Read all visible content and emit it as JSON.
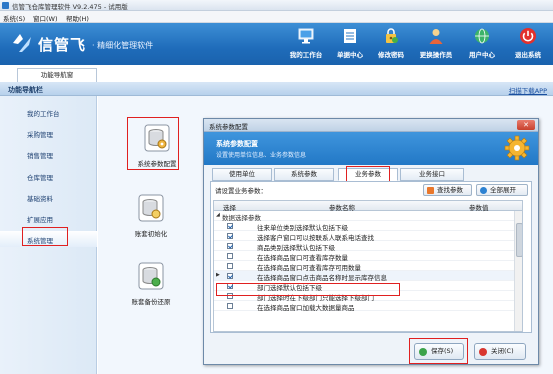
{
  "window": {
    "title": "信管飞仓库管理软件 V9.2.475 - 试用版"
  },
  "menu": {
    "items": [
      "系统(S)",
      "窗口(W)",
      "帮助(H)"
    ]
  },
  "brand": {
    "logo_text": "信管飞",
    "slogan": "· 精细化管理软件",
    "accent": "#1f6cba"
  },
  "toolbar": {
    "items": [
      {
        "label": "我的工作台",
        "icon": "monitor-icon"
      },
      {
        "label": "单据中心",
        "icon": "document-icon"
      },
      {
        "label": "修改密码",
        "icon": "key-icon"
      },
      {
        "label": "更换操作员",
        "icon": "user-icon"
      },
      {
        "label": "用户中心",
        "icon": "globe-icon"
      },
      {
        "label": "退出系统",
        "icon": "power-icon"
      }
    ]
  },
  "nav_tab": {
    "label": "功能导航窗"
  },
  "nav_header": {
    "title": "功能导航栏",
    "download_link": "扫描下载APP"
  },
  "sidebar": {
    "items": [
      {
        "label": "我的工作台"
      },
      {
        "label": "采购管理"
      },
      {
        "label": "销售管理"
      },
      {
        "label": "仓库管理"
      },
      {
        "label": "基础资料"
      },
      {
        "label": "扩展应用"
      },
      {
        "label": "系统管理"
      }
    ],
    "selected": "系统管理"
  },
  "tiles": [
    {
      "label": "系统参数配置",
      "icon": "database-gear-icon"
    },
    {
      "label": "账套初始化",
      "icon": "database-icon"
    },
    {
      "label": "账套备份还原",
      "icon": "database-restore-icon"
    }
  ],
  "dialog": {
    "title": "系统参数配置",
    "close_glyph": "✕",
    "band_heading": "系统参数配置",
    "band_subtitle": "设置使用单位信息、业务参数信息",
    "tabs": [
      {
        "label": "使用单位"
      },
      {
        "label": "系统参数"
      },
      {
        "label": "业务参数"
      },
      {
        "label": "业务接口"
      }
    ],
    "active_tab": "业务参数",
    "query_label": "请设置业务参数：",
    "find_button": "查找参数",
    "expand_button": "全部展开",
    "grid": {
      "columns": [
        "选择",
        "参数名称",
        "参数值"
      ],
      "group_label": "数据选择参数",
      "rows": [
        {
          "name": "往来单位类别选择默认包括下级",
          "checked": true
        },
        {
          "name": "选择客户窗口可以按联系人联系电话查找",
          "checked": true
        },
        {
          "name": "商品类别选择默认包括下级",
          "checked": true
        },
        {
          "name": "在选择商品窗口可查看库存数量",
          "checked": false
        },
        {
          "name": "在选择商品窗口可查看库存可用数量",
          "checked": false
        },
        {
          "name": "在选择商品窗口点击商品名称时显示库存信息",
          "checked": true
        },
        {
          "name": "部门选择默认包括下级",
          "checked": true
        },
        {
          "name": "部门选择时在下级部门只能选择下级部门",
          "checked": false
        },
        {
          "name": "在选择商品窗口加载大数据量商品",
          "checked": false
        }
      ],
      "highlighted_row": "在选择商品窗口点击商品名称时显示库存信息"
    },
    "save_button": "保存(S)",
    "close_button": "关闭(C)"
  }
}
